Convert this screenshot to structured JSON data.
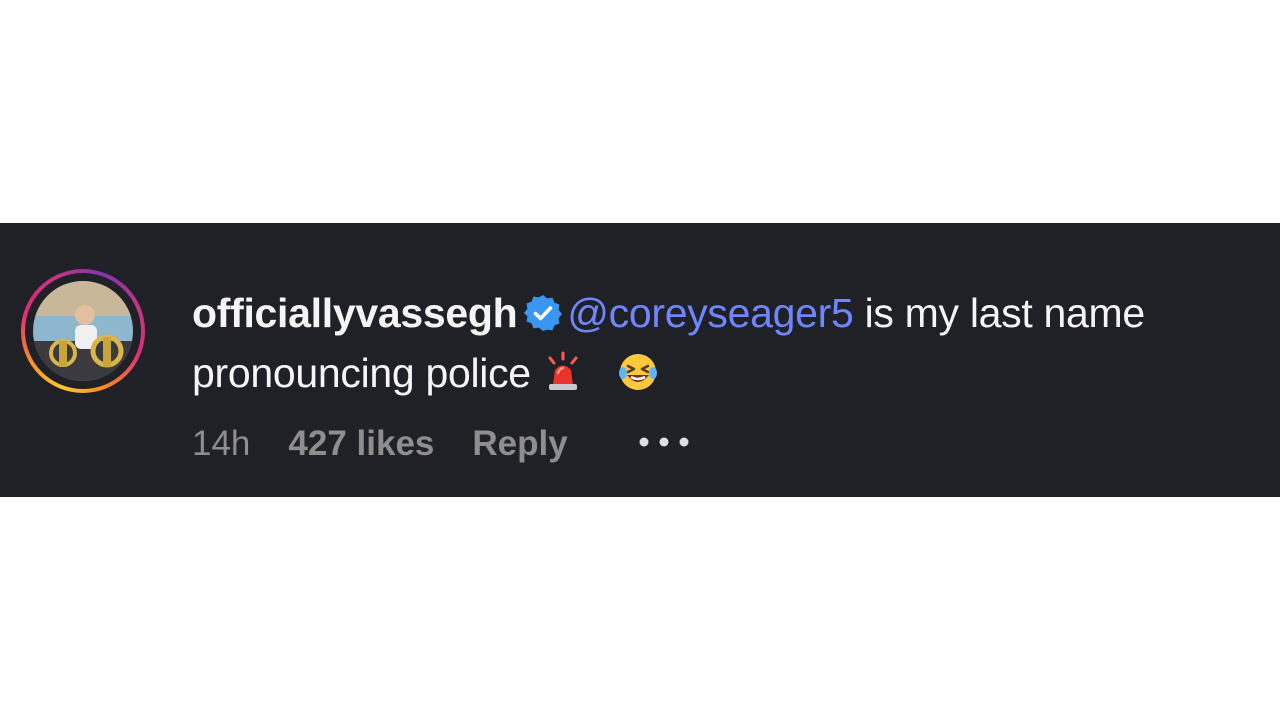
{
  "comment": {
    "username": "officiallyvassegh",
    "verified": true,
    "mention": "@coreyseager5",
    "text_after_mention": " is my last name pronouncing police ",
    "emojis": [
      "police-light-emoji",
      "laughing-tears-emoji"
    ],
    "time": "14h",
    "likes": "427 likes",
    "reply_label": "Reply",
    "more_icon": "more-horizontal-icon"
  },
  "colors": {
    "background": "#202127",
    "text": "#f5f5f5",
    "mention": "#6f86ff",
    "meta": "#8e8e8e",
    "verified": "#3897f0"
  }
}
